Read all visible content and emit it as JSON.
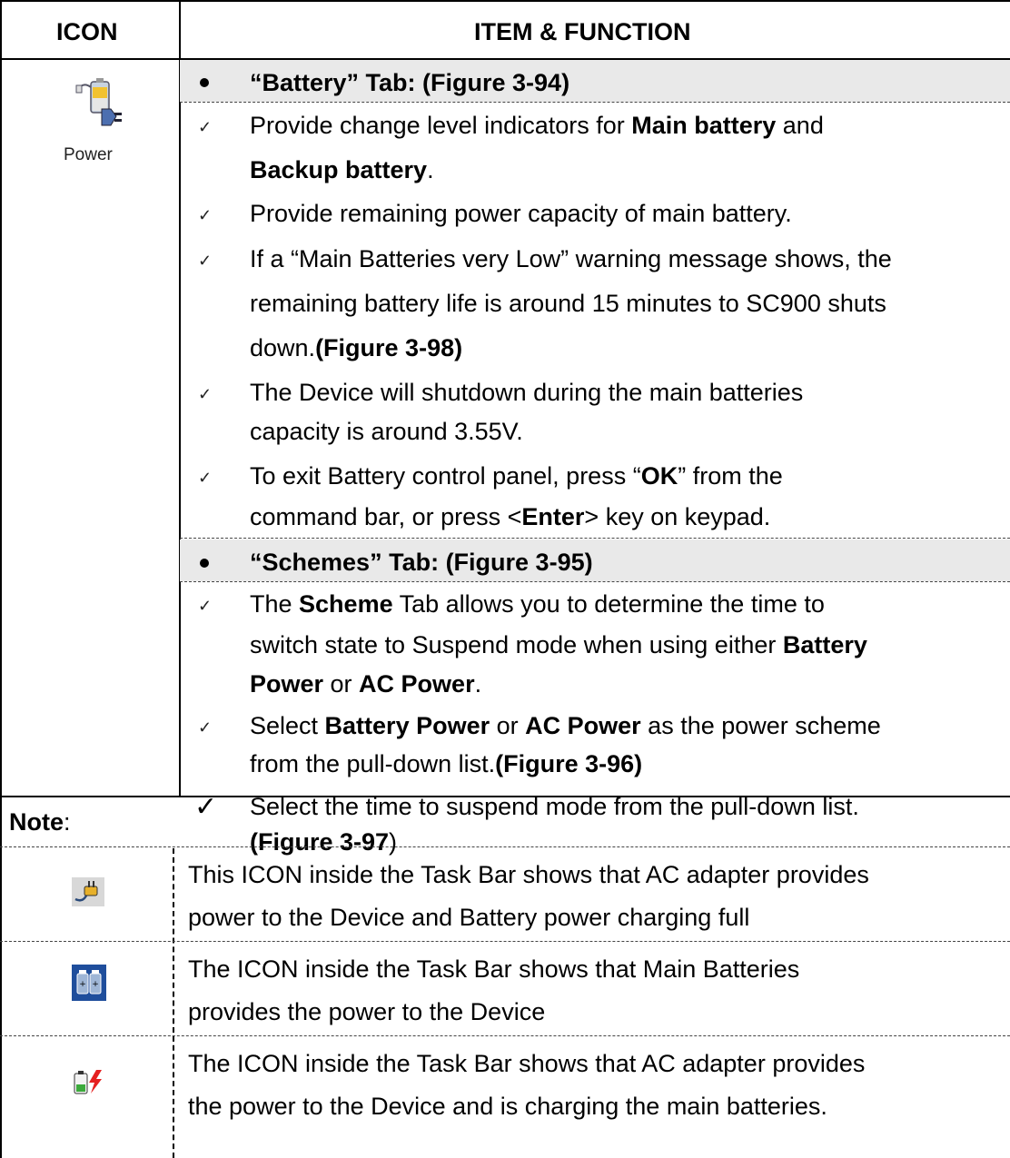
{
  "header": {
    "icon_col": "ICON",
    "item_col": "ITEM & FUNCTION"
  },
  "icon": {
    "name": "power-icon",
    "label": "Power"
  },
  "battery_tab": {
    "title": "“Battery” Tab: (Figure 3-94)",
    "items": [
      [
        [
          "Provide change level indicators for ",
          ""
        ],
        [
          "Main battery",
          "b"
        ],
        [
          " and",
          ""
        ]
      ],
      [
        [
          "Backup battery",
          "b"
        ],
        [
          ".",
          ""
        ]
      ],
      [
        [
          "Provide remaining power capacity of main battery.",
          ""
        ]
      ],
      [
        [
          "If a “Main Batteries very Low” warning message shows, the",
          ""
        ]
      ],
      [
        [
          "remaining battery life is around 15 minutes to SC900 shuts",
          ""
        ]
      ],
      [
        [
          "down.",
          ""
        ],
        [
          "(Figure 3-98)",
          "b"
        ]
      ],
      [
        [
          "The Device will shutdown during the main batteries",
          ""
        ]
      ],
      [
        [
          "capacity is around 3.55V.",
          ""
        ]
      ],
      [
        [
          "To exit Battery control panel, press “",
          ""
        ],
        [
          "OK",
          "b"
        ],
        [
          "” from the",
          ""
        ]
      ],
      [
        [
          "command bar, or press <",
          ""
        ],
        [
          "Enter",
          "b"
        ],
        [
          "> key on keypad.",
          ""
        ]
      ]
    ]
  },
  "schemes_tab": {
    "title": "“Schemes” Tab: (Figure 3-95)",
    "items": [
      [
        [
          "The ",
          ""
        ],
        [
          "Scheme",
          "b"
        ],
        [
          " Tab allows you to determine the time to",
          ""
        ]
      ],
      [
        [
          "switch state to Suspend mode when using either ",
          ""
        ],
        [
          "Battery",
          "b"
        ]
      ],
      [
        [
          "Power",
          "b"
        ],
        [
          " or ",
          ""
        ],
        [
          "AC Power",
          "b"
        ],
        [
          ".",
          ""
        ]
      ],
      [
        [
          "Select ",
          ""
        ],
        [
          "Battery Power",
          "b"
        ],
        [
          " or ",
          ""
        ],
        [
          "AC Power",
          "b"
        ],
        [
          " as the power scheme",
          ""
        ]
      ],
      [
        [
          "from the pull-down list.",
          ""
        ],
        [
          "(Figure 3-96)",
          "b"
        ]
      ],
      [
        [
          "Select the time to suspend mode from the pull-down list.",
          ""
        ]
      ],
      [
        [
          "(Figure 3-97",
          "b"
        ],
        [
          ")",
          ""
        ]
      ]
    ]
  },
  "note": {
    "label": "Note",
    "colon": ":",
    "rows": [
      {
        "icon": "ac-plug-icon",
        "lines": [
          "This ICON inside the Task Bar shows that AC adapter provides",
          "power to the Device and Battery power charging full"
        ]
      },
      {
        "icon": "main-batteries-icon",
        "lines": [
          "The ICON inside the Task Bar shows that Main Batteries",
          "provides the power to the Device"
        ]
      },
      {
        "icon": "battery-charging-icon",
        "lines": [
          "The ICON inside the Task Bar shows that AC adapter provides",
          "the power to the Device and is charging the main batteries."
        ]
      }
    ]
  }
}
